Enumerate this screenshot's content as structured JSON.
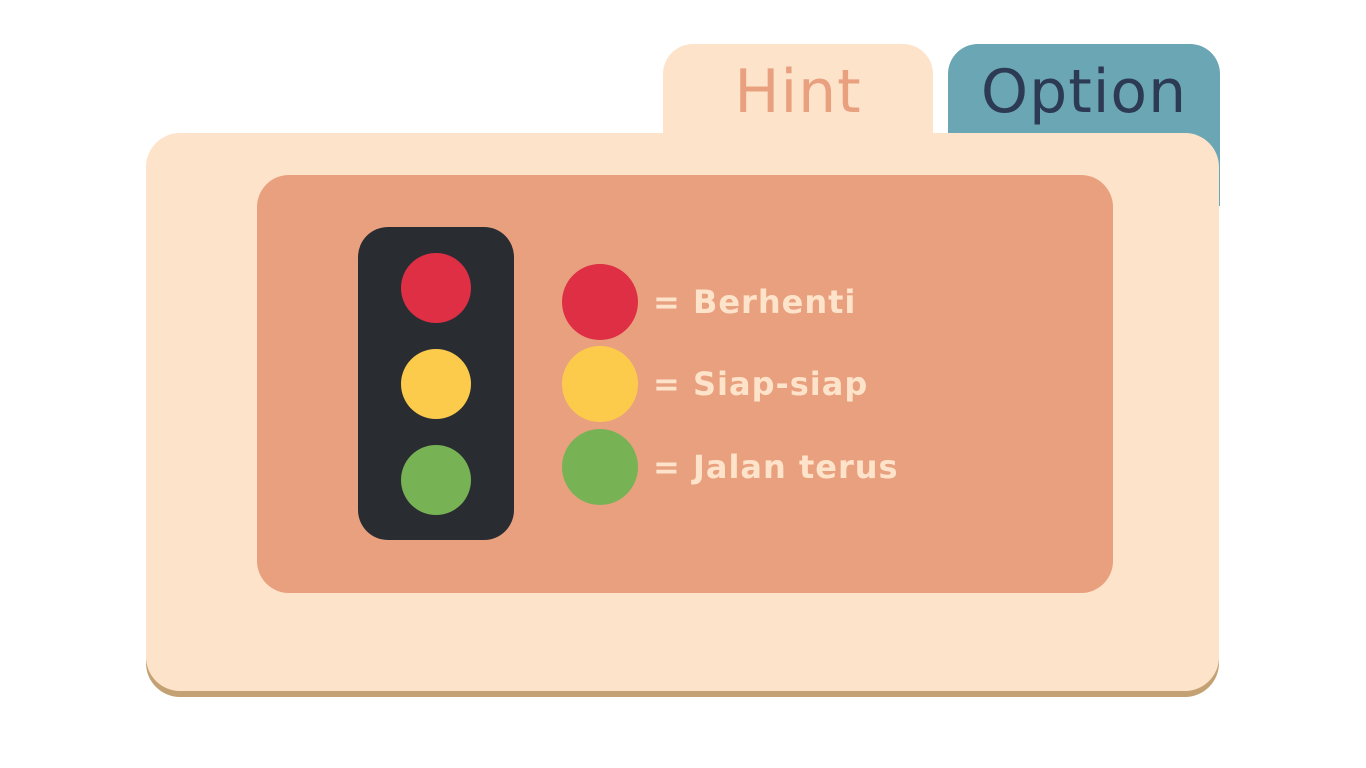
{
  "tabs": {
    "hint_label": "Hint",
    "option_label": "Option"
  },
  "traffic_light": {
    "lamps": [
      {
        "name": "red",
        "color": "#de2f44"
      },
      {
        "name": "yellow",
        "color": "#fdcb4b"
      },
      {
        "name": "green",
        "color": "#77b255"
      }
    ]
  },
  "legend": {
    "items": [
      {
        "color": "#de2f44",
        "text": "= Berhenti"
      },
      {
        "color": "#fdcb4b",
        "text": "= Siap-siap"
      },
      {
        "color": "#77b255",
        "text": "= Jalan terus"
      }
    ]
  },
  "colors": {
    "panel": "#fee3cb",
    "content": "#e9a07e",
    "option_tab": "#6ba6b4",
    "panel_shadow": "#c4a172",
    "traffic_light_body": "#292d32"
  }
}
